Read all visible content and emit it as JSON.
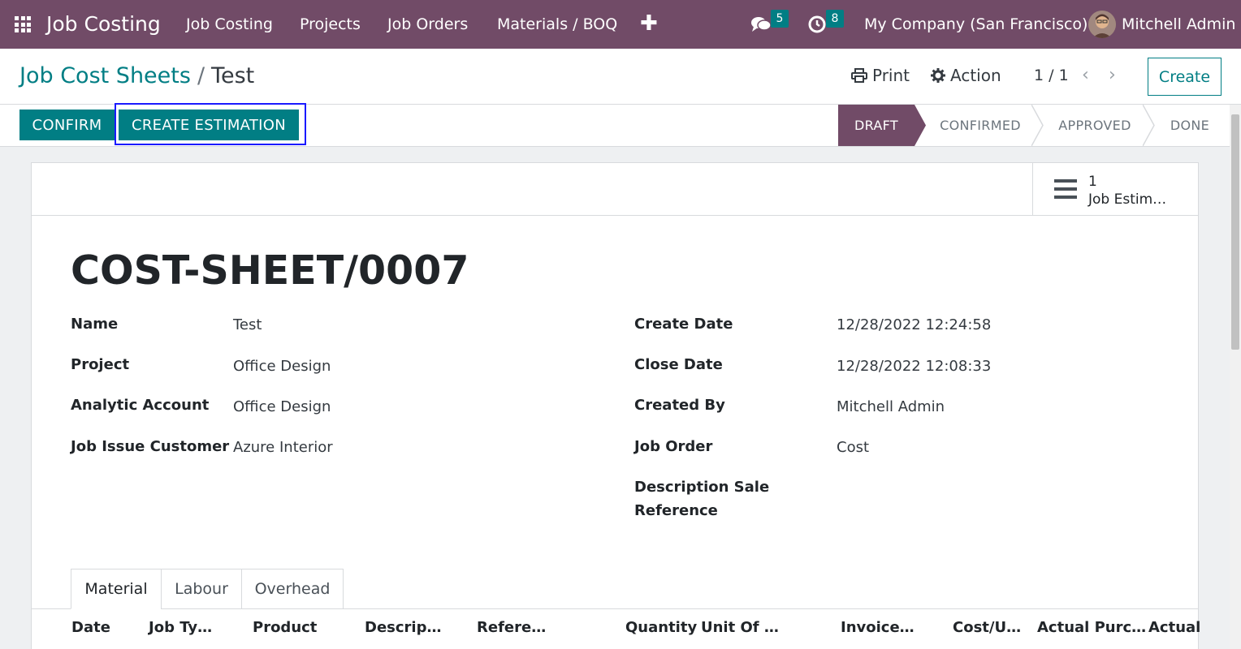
{
  "navbar": {
    "brand": "Job Costing",
    "menu": [
      "Job Costing",
      "Projects",
      "Job Orders",
      "Materials / BOQ"
    ],
    "plus": "✚",
    "messages_count": "5",
    "activities_count": "8",
    "company": "My Company (San Francisco)",
    "user": "Mitchell Admin"
  },
  "control_panel": {
    "breadcrumb_parent": "Job Cost Sheets",
    "breadcrumb_sep": "/",
    "breadcrumb_current": "Test",
    "print_label": "Print",
    "action_label": "Action",
    "pager": "1 / 1",
    "prev": "‹",
    "next": "›",
    "create_label": "Create"
  },
  "statusbar": {
    "confirm_label": "CONFIRM",
    "create_estimation_label": "CREATE ESTIMATION",
    "stages": [
      "DRAFT",
      "CONFIRMED",
      "APPROVED",
      "DONE"
    ],
    "active_stage": "DRAFT"
  },
  "smart_button": {
    "count": "1",
    "label": "Job Estim…"
  },
  "form": {
    "title": "COST-SHEET/0007",
    "left_fields": [
      {
        "label": "Name",
        "value": "Test"
      },
      {
        "label": "Project",
        "value": "Office Design"
      },
      {
        "label": "Analytic Account",
        "value": "Office Design"
      },
      {
        "label": "Job Issue Customer",
        "value": "Azure Interior"
      }
    ],
    "right_fields": [
      {
        "label": "Create Date",
        "value": "12/28/2022 12:24:58"
      },
      {
        "label": "Close Date",
        "value": "12/28/2022 12:08:33"
      },
      {
        "label": "Created By",
        "value": "Mitchell Admin"
      },
      {
        "label": "Job Order",
        "value": "Cost"
      },
      {
        "label": "Description Sale",
        "value": ""
      },
      {
        "label": "Reference",
        "value": ""
      }
    ]
  },
  "tabs": [
    "Material",
    "Labour",
    "Overhead"
  ],
  "table_columns": [
    "Date",
    "Job Ty…",
    "Product",
    "Descrip…",
    "Refere…",
    "Quantity",
    "Unit Of …",
    "Invoice…",
    "Cost/U…",
    "Actual Purc…",
    "Actual"
  ],
  "colors": {
    "brand": "#714b67",
    "primary": "#017e84",
    "highlight": "#1a1aff"
  }
}
